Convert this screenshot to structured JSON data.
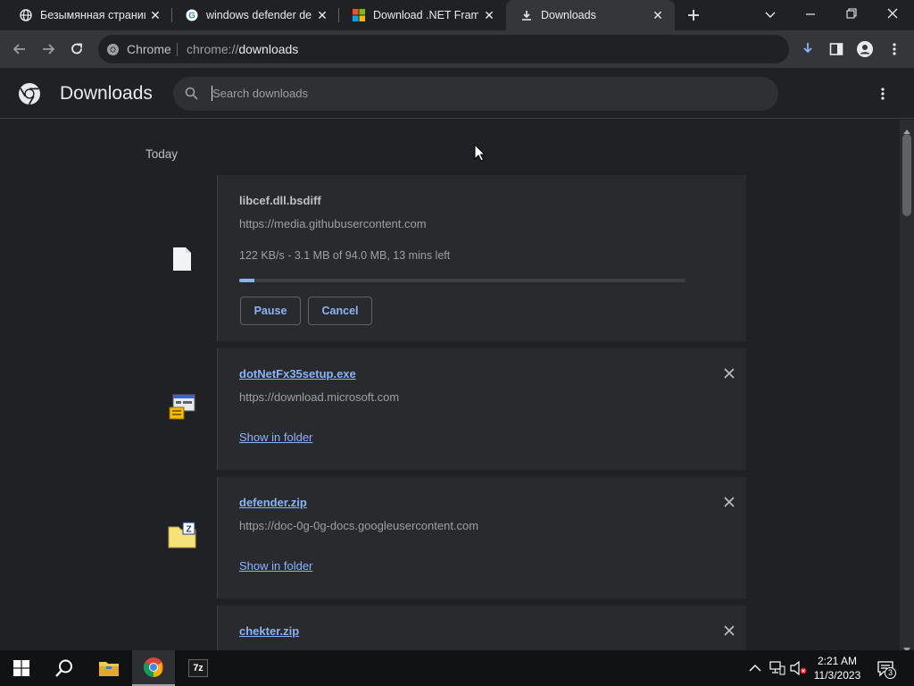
{
  "tabs": [
    {
      "title": "Безымянная страница",
      "icon": "globe-icon"
    },
    {
      "title": "windows defender def",
      "icon": "google-icon"
    },
    {
      "title": "Download .NET Frame",
      "icon": "microsoft-icon"
    },
    {
      "title": "Downloads",
      "icon": "download-icon"
    }
  ],
  "omnibox": {
    "site_label": "Chrome",
    "url_prefix": "chrome://",
    "url_path": "downloads"
  },
  "header": {
    "title": "Downloads",
    "search_placeholder": "Search downloads"
  },
  "section_label": "Today",
  "downloads": [
    {
      "name": "libcef.dll.bsdiff",
      "source": "https://media.githubusercontent.com",
      "status": "122 KB/s - 3.1 MB of 94.0 MB, 13 mins left",
      "progress_fraction": 0.033,
      "pause_label": "Pause",
      "cancel_label": "Cancel",
      "icon": "file-icon"
    },
    {
      "name": "dotNetFx35setup.exe",
      "source": "https://download.microsoft.com",
      "action_label": "Show in folder",
      "icon": "setup-exe-icon"
    },
    {
      "name": "defender.zip",
      "source": "https://doc-0g-0g-docs.googleusercontent.com",
      "action_label": "Show in folder",
      "icon": "zip-archive-icon"
    },
    {
      "name": "chekter.zip",
      "icon": "zip-archive-icon"
    }
  ],
  "taskbar": {
    "apps": [
      "windows-start-icon",
      "search-icon",
      "file-explorer-icon",
      "chrome-icon",
      "7zip-icon"
    ],
    "sevenzip_label": "7z",
    "time": "2:21 AM",
    "date": "11/3/2023",
    "notification_count": "3"
  },
  "colors": {
    "accent": "#8ab4f8",
    "background": "#202124",
    "card": "#292a2d"
  }
}
